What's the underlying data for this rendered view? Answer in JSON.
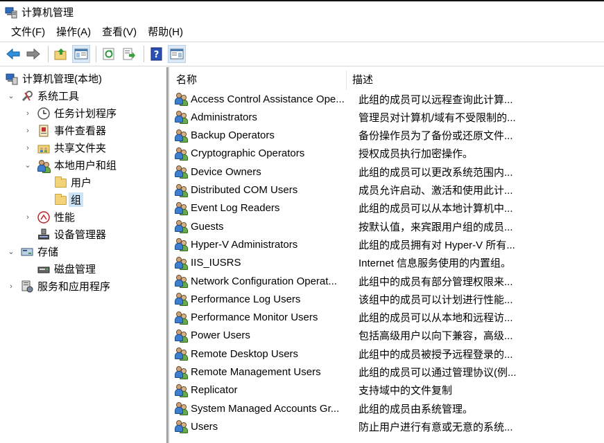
{
  "window": {
    "title": "计算机管理"
  },
  "menu": [
    "文件(F)",
    "操作(A)",
    "查看(V)",
    "帮助(H)"
  ],
  "toolbar": {
    "buttons": [
      "back-icon",
      "forward-icon",
      "up-folder-icon",
      "show-hide-tree-icon",
      "refresh-icon",
      "export-list-icon",
      "help-icon",
      "show-hide-action-pane-icon"
    ]
  },
  "tree": [
    {
      "label": "计算机管理(本地)",
      "level": 0,
      "arrow": "",
      "icon": "computer-management-icon"
    },
    {
      "label": "系统工具",
      "level": 1,
      "arrow": "⌄",
      "icon": "system-tools-icon"
    },
    {
      "label": "任务计划程序",
      "level": 2,
      "arrow": "›",
      "icon": "task-scheduler-icon"
    },
    {
      "label": "事件查看器",
      "level": 2,
      "arrow": "›",
      "icon": "event-viewer-icon"
    },
    {
      "label": "共享文件夹",
      "level": 2,
      "arrow": "›",
      "icon": "shared-folders-icon"
    },
    {
      "label": "本地用户和组",
      "level": 2,
      "arrow": "⌄",
      "icon": "local-users-groups-icon"
    },
    {
      "label": "用户",
      "level": 3,
      "arrow": "",
      "icon": "folder-icon"
    },
    {
      "label": "组",
      "level": 3,
      "arrow": "",
      "icon": "folder-icon",
      "selected": true
    },
    {
      "label": "性能",
      "level": 2,
      "arrow": "›",
      "icon": "performance-icon"
    },
    {
      "label": "设备管理器",
      "level": 2,
      "arrow": "",
      "icon": "device-manager-icon"
    },
    {
      "label": "存储",
      "level": 1,
      "arrow": "⌄",
      "icon": "storage-icon"
    },
    {
      "label": "磁盘管理",
      "level": 2,
      "arrow": "",
      "icon": "disk-management-icon"
    },
    {
      "label": "服务和应用程序",
      "level": 1,
      "arrow": "›",
      "icon": "services-apps-icon"
    }
  ],
  "list": {
    "columns": {
      "name": "名称",
      "description": "描述"
    },
    "rows": [
      {
        "name": "Access Control Assistance Ope...",
        "description": "此组的成员可以远程查询此计算..."
      },
      {
        "name": "Administrators",
        "description": "管理员对计算机/域有不受限制的..."
      },
      {
        "name": "Backup Operators",
        "description": "备份操作员为了备份或还原文件..."
      },
      {
        "name": "Cryptographic Operators",
        "description": "授权成员执行加密操作。"
      },
      {
        "name": "Device Owners",
        "description": "此组的成员可以更改系统范围内..."
      },
      {
        "name": "Distributed COM Users",
        "description": "成员允许启动、激活和使用此计..."
      },
      {
        "name": "Event Log Readers",
        "description": "此组的成员可以从本地计算机中..."
      },
      {
        "name": "Guests",
        "description": "按默认值，来宾跟用户组的成员..."
      },
      {
        "name": "Hyper-V Administrators",
        "description": "此组的成员拥有对 Hyper-V 所有..."
      },
      {
        "name": "IIS_IUSRS",
        "description": "Internet 信息服务使用的内置组。"
      },
      {
        "name": "Network Configuration Operat...",
        "description": "此组中的成员有部分管理权限来..."
      },
      {
        "name": "Performance Log Users",
        "description": "该组中的成员可以计划进行性能..."
      },
      {
        "name": "Performance Monitor Users",
        "description": "此组的成员可以从本地和远程访..."
      },
      {
        "name": "Power Users",
        "description": "包括高级用户以向下兼容，高级..."
      },
      {
        "name": "Remote Desktop Users",
        "description": "此组中的成员被授予远程登录的..."
      },
      {
        "name": "Remote Management Users",
        "description": "此组的成员可以通过管理协议(例..."
      },
      {
        "name": "Replicator",
        "description": "支持域中的文件复制"
      },
      {
        "name": "System Managed Accounts Gr...",
        "description": "此组的成员由系统管理。"
      },
      {
        "name": "Users",
        "description": "防止用户进行有意或无意的系统..."
      }
    ]
  }
}
